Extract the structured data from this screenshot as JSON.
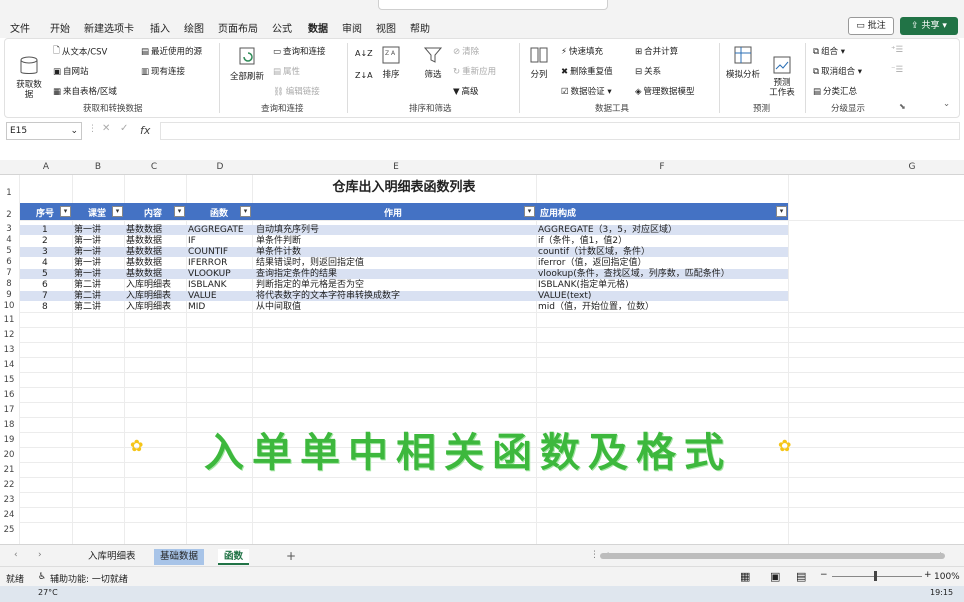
{
  "menu": {
    "items": [
      "文件",
      "开始",
      "新建选项卡",
      "插入",
      "绘图",
      "页面布局",
      "公式",
      "数据",
      "审阅",
      "视图",
      "帮助"
    ],
    "active": "数据",
    "comment": "批注",
    "share": "共享"
  },
  "ribbon": {
    "get": {
      "big": "获取数\n据",
      "csv": "从文本/CSV",
      "web": "自网站",
      "table": "来自表格/区域",
      "recent": "最近使用的源",
      "existing": "现有连接",
      "label": "获取和转换数据"
    },
    "query": {
      "refresh": "全部刷新",
      "queries": "查询和连接",
      "props": "属性",
      "edit_links": "编辑链接",
      "label": "查询和连接"
    },
    "sort": {
      "az": "A↓Z",
      "za": "Z↓A",
      "sort": "排序",
      "filter": "筛选",
      "clear": "清除",
      "reapply": "重新应用",
      "advanced": "高级",
      "label": "排序和筛选"
    },
    "tools": {
      "split": "分列",
      "flash": "快速填充",
      "dedup": "删除重复值",
      "validate": "数据验证",
      "consolidate": "合并计算",
      "relations": "关系",
      "model": "管理数据模型",
      "label": "数据工具"
    },
    "forecast": {
      "whatif": "模拟分析",
      "sheet": "预测\n工作表",
      "label": "预测"
    },
    "outline": {
      "group": "组合",
      "ungroup": "取消组合",
      "subtotal": "分类汇总",
      "label": "分级显示"
    }
  },
  "formula_bar": {
    "cell": "E15",
    "fx": "fx",
    "value": ""
  },
  "columns": [
    "A",
    "B",
    "C",
    "D",
    "E",
    "F",
    "G"
  ],
  "rows": [
    "1",
    "2",
    "3",
    "4",
    "5",
    "6",
    "7",
    "8",
    "9",
    "10",
    "11",
    "12",
    "13",
    "14",
    "15",
    "16",
    "17",
    "18",
    "19",
    "20",
    "21",
    "22",
    "23",
    "24",
    "25",
    "26",
    "27",
    "28",
    "29",
    "30"
  ],
  "sheet": {
    "title": "仓库出入明细表函数列表",
    "headers": [
      "序号",
      "课堂",
      "内容",
      "函数",
      "作用",
      "应用构成"
    ],
    "rows": [
      [
        "1",
        "第一讲",
        "基数数据",
        "AGGREGATE",
        "自动填充序列号",
        "AGGREGATE（3，5，对应区域）"
      ],
      [
        "2",
        "第一讲",
        "基数数据",
        "IF",
        "单条件判断",
        "if（条件，值1，值2）"
      ],
      [
        "3",
        "第一讲",
        "基数数据",
        "COUNTIF",
        "单条件计数",
        "countif（计数区域，条件）"
      ],
      [
        "4",
        "第一讲",
        "基数数据",
        "IFERROR",
        "结果错误时，则返回指定值",
        "iferror（值，返回指定值）"
      ],
      [
        "5",
        "第一讲",
        "基数数据",
        "VLOOKUP",
        "查询指定条件的结果",
        "vlookup(条件，查找区域，列序数，匹配条件）"
      ],
      [
        "6",
        "第二讲",
        "入库明细表",
        "ISBLANK",
        "判断指定的单元格是否为空",
        "ISBLANK(指定单元格)"
      ],
      [
        "7",
        "第二讲",
        "入库明细表",
        "VALUE",
        "将代表数字的文本字符串转换成数字",
        "VALUE(text)"
      ],
      [
        "8",
        "第二讲",
        "入库明细表",
        "MID",
        "从中间取值",
        "mid（值，开始位置，位数）"
      ]
    ]
  },
  "banner": "入单单中相关函数及格式",
  "tabs": [
    "入库明细表",
    "基础数据",
    "函数"
  ],
  "active_tab": "函数",
  "status": {
    "ready": "就绪",
    "access": "辅助功能: 一切就绪",
    "zoom": "100%"
  },
  "taskbar": {
    "temp": "27°C",
    "time": "19:15"
  }
}
